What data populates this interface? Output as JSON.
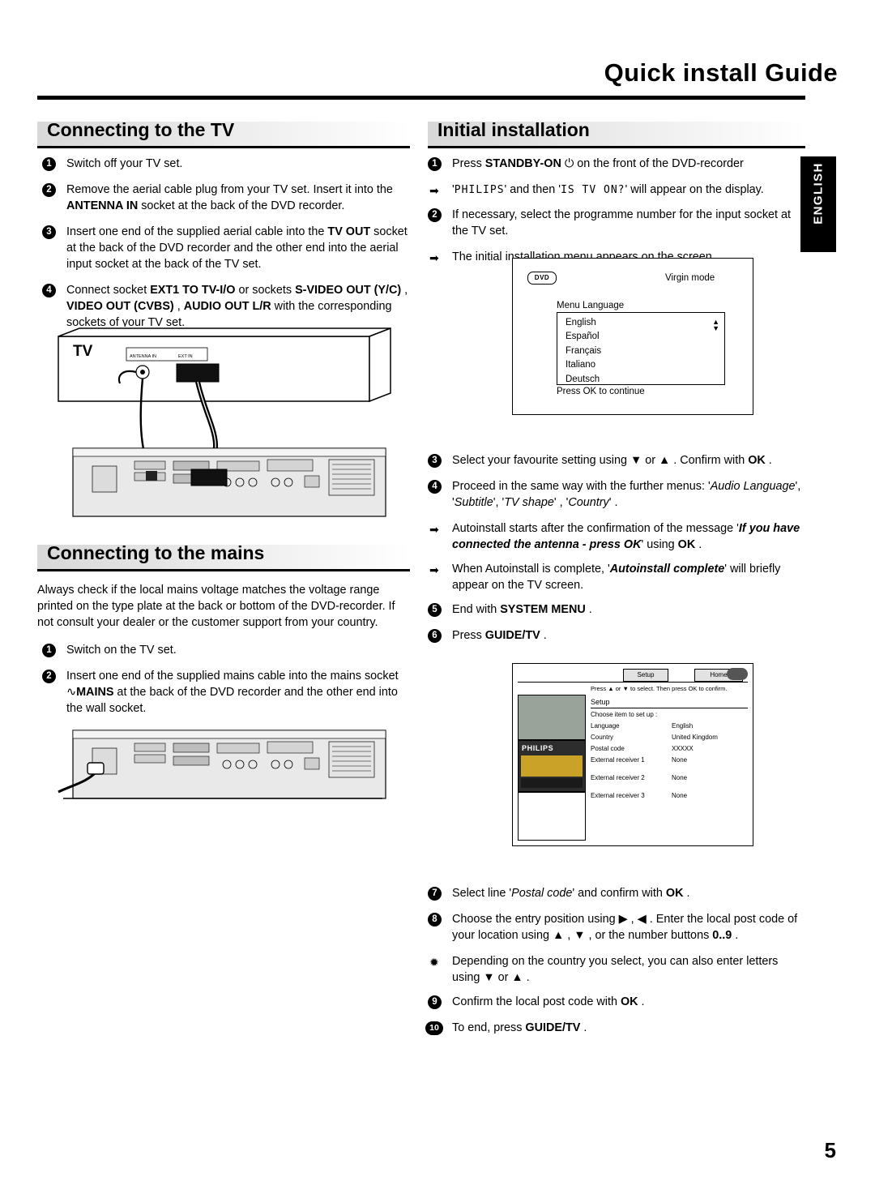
{
  "header": {
    "title": "Quick install Guide",
    "side_tab": "ENGLISH",
    "page_number": "5"
  },
  "left_column": {
    "section1": {
      "heading": "Connecting to the TV",
      "steps": [
        {
          "num": "1",
          "html": "Switch off your TV set."
        },
        {
          "num": "2",
          "html": "Remove the aerial cable plug from your TV set. Insert it into the <b>ANTENNA IN</b> socket at the back of the DVD recorder."
        },
        {
          "num": "3",
          "html": "Insert one end of the supplied aerial cable into the <b>TV OUT</b> socket at the back of the DVD recorder and the other end into the aerial input socket at the back of the TV set."
        },
        {
          "num": "4",
          "html": "Connect socket <b>EXT1 TO TV-I/O</b> or sockets <b>S-VIDEO OUT (Y/C)</b> , <b>VIDEO OUT (CVBS)</b> , <b>AUDIO OUT L/R</b> with the corresponding sockets of your TV set."
        }
      ]
    },
    "figure1": {
      "tv_label": "TV",
      "socket_labels": [
        "ANTENNA IN",
        "EXT IN"
      ]
    },
    "section2": {
      "heading": "Connecting to the mains",
      "intro": "Always check if the local mains voltage matches the voltage range printed on the type plate at the back or bottom of the DVD-recorder. If not consult your dealer or the customer support from your country.",
      "steps": [
        {
          "num": "1",
          "html": "Switch on the TV set."
        },
        {
          "num": "2",
          "html": "Insert one end of the supplied mains cable into the mains socket <span class=\"mains-sym\">∿</span><b>MAINS</b> at the back of the DVD recorder and the other end into the wall socket."
        }
      ]
    }
  },
  "right_column": {
    "section1": {
      "heading": "Initial installation",
      "steps": [
        {
          "num": "1",
          "html": "Press <b>STANDBY-ON</b> <span class=\"pw\">⏻</span> on the front of the DVD-recorder"
        },
        {
          "arrow": true,
          "html": "'<span class=\"mono\">PHILIPS</span>' and then '<span class=\"mono\">IS TV ON?</span>' will appear on the display."
        },
        {
          "num": "2",
          "html": "If necessary, select the programme number for the input socket at the TV set."
        },
        {
          "arrow": true,
          "html": "The initial installation menu appears on the screen."
        }
      ],
      "steps2": [
        {
          "num": "3",
          "html": "Select your favourite setting using ▼ or ▲ . Confirm with <b>OK</b> ."
        },
        {
          "num": "4",
          "html": "Proceed in the same way with the further menus: '<i>Audio Language</i>', '<i>Subtitle</i>', '<i>TV shape</i>' , '<i>Country</i>' ."
        },
        {
          "arrow": true,
          "html": "Autoinstall starts after the confirmation of the message '<b><i>If you have connected the antenna - press OK</i></b>' using <b>OK</b> ."
        },
        {
          "arrow": true,
          "html": "When Autoinstall is complete, '<b><i>Autoinstall complete</i></b>' will briefly appear on the TV screen."
        },
        {
          "num": "5",
          "html": "End with <b>SYSTEM MENU</b> ."
        },
        {
          "num": "6",
          "html": "Press <b>GUIDE/TV</b> ."
        }
      ],
      "steps3": [
        {
          "num": "7",
          "html": "Select line '<i>Postal code</i>' and confirm with <b>OK</b> ."
        },
        {
          "num": "8",
          "html": "Choose the entry position using ▶ , ◀ . Enter the local post code of your location using ▲ , ▼ , or the number buttons <b>0..9</b> ."
        },
        {
          "circ": true,
          "html": "Depending on the country you select, you can also enter letters using ▼ or ▲ ."
        },
        {
          "num": "9",
          "html": "Confirm the local post code with <b>OK</b> ."
        },
        {
          "num": "10",
          "html": "To end, press <b>GUIDE/TV</b> ."
        }
      ]
    },
    "osd_virgin": {
      "logo": "DVD",
      "mode": "Virgin mode",
      "menu_label": "Menu Language",
      "languages": [
        "English",
        "Español",
        "Français",
        "Italiano",
        "Deutsch"
      ],
      "footer": "Press OK to continue"
    },
    "osd_setup": {
      "tab_setup": "Setup",
      "tab_home": "Home",
      "hint": "Press ▲ or ▼ to select. Then press OK to confirm.",
      "title": "Setup",
      "subtitle": "Choose item to set up :",
      "brand": "PHILIPS",
      "rows": [
        {
          "label": "Language",
          "value": "English"
        },
        {
          "label": "Country",
          "value": "United Kingdom"
        },
        {
          "label": "Postal code",
          "value": "XXXXX"
        },
        {
          "label": "External receiver 1",
          "value": "None"
        },
        {
          "label": "External receiver 2",
          "value": "None"
        },
        {
          "label": "External receiver 3",
          "value": "None"
        }
      ]
    }
  }
}
